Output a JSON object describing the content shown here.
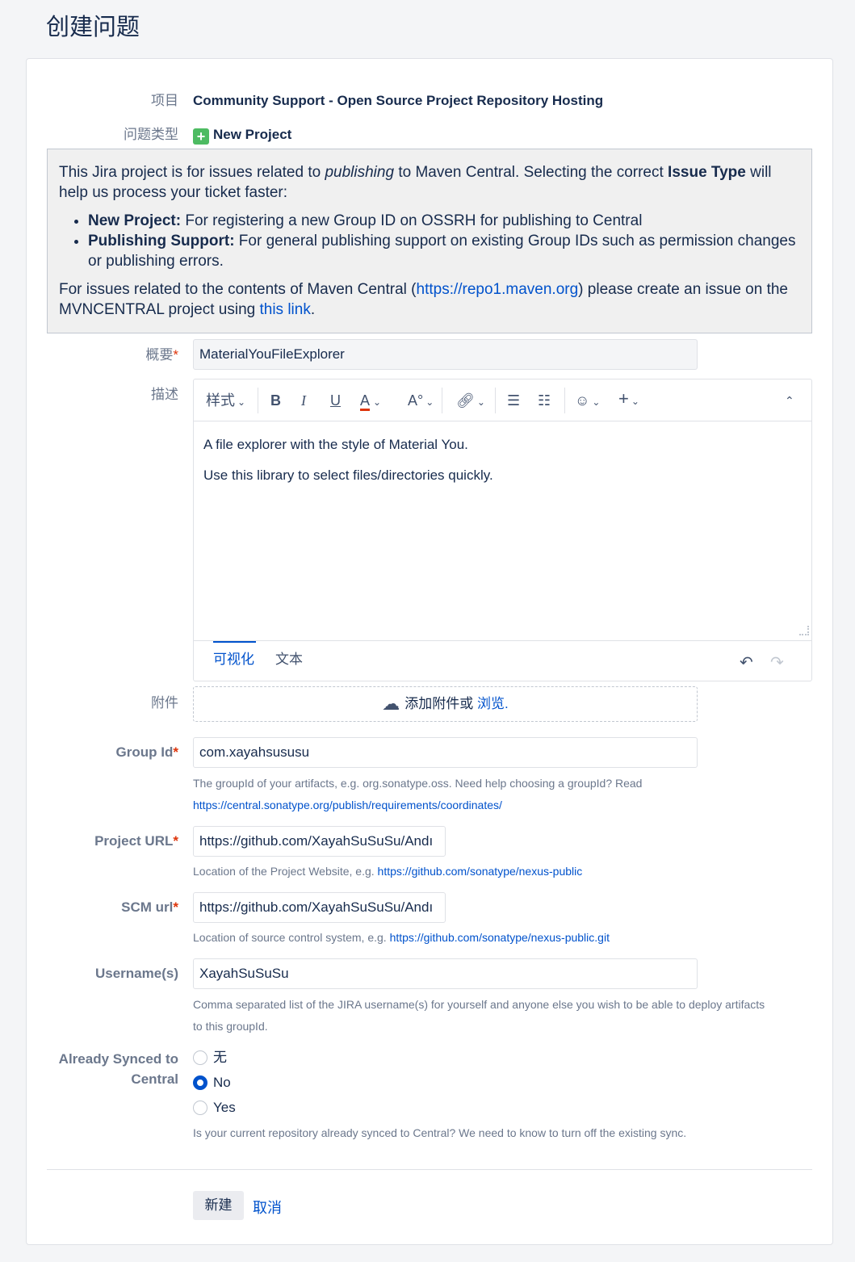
{
  "page_title": "创建问题",
  "fields": {
    "project": {
      "label": "项目",
      "value": "Community Support - Open Source Project Repository Hosting"
    },
    "issue_type": {
      "label": "问题类型",
      "value": "New Project"
    },
    "summary": {
      "label": "概要",
      "value": "MaterialYouFileExplorer"
    },
    "description": {
      "label": "描述",
      "lines": [
        "A file explorer with the style of Material You.",
        "Use this library to select files/directories quickly."
      ]
    },
    "attachment": {
      "label": "附件",
      "text": "添加附件或",
      "link": "浏览."
    },
    "group_id": {
      "label": "Group Id",
      "value": "com.xayahsususu",
      "help": "The groupId of your artifacts, e.g. org.sonatype.oss. Need help choosing a groupId? Read",
      "help_link": "https://central.sonatype.org/publish/requirements/coordinates/"
    },
    "project_url": {
      "label": "Project URL",
      "value": "https://github.com/XayahSuSuSu/Andı",
      "help": "Location of the Project Website, e.g.",
      "help_link": "https://github.com/sonatype/nexus-public"
    },
    "scm_url": {
      "label": "SCM url",
      "value": "https://github.com/XayahSuSuSu/Andı",
      "help": "Location of source control system, e.g.",
      "help_link": "https://github.com/sonatype/nexus-public.git"
    },
    "usernames": {
      "label": "Username(s)",
      "value": "XayahSuSuSu",
      "help_line1": "Comma separated list of the JIRA username(s) for yourself and anyone else you wish to be able to deploy artifacts",
      "help_line2": "to this groupId."
    },
    "synced": {
      "label_line1": "Already Synced to",
      "label_line2": "Central",
      "options": [
        "无",
        "No",
        "Yes"
      ],
      "selected": "No",
      "help": "Is your current repository already synced to Central? We need to know to turn off the existing sync."
    }
  },
  "info": {
    "p1_a": "This Jira project is for issues related to ",
    "p1_em": "publishing",
    "p1_b": " to Maven Central. Selecting the correct ",
    "p1_strong": "Issue Type",
    "p1_c": " will help us process your ticket faster:",
    "bullet1_strong": "New Project:",
    "bullet1_text": " For registering a new Group ID on OSSRH for publishing to Central",
    "bullet2_strong": "Publishing Support:",
    "bullet2_text": " For general publishing support on existing Group IDs such as permission changes or publishing errors.",
    "p2_a": "For issues related to the contents of Maven Central (",
    "p2_link": "https://repo1.maven.org",
    "p2_b": ") please create an issue on the MVNCENTRAL project using ",
    "p2_link2": "this link",
    "p2_c": "."
  },
  "editor": {
    "style_label": "样式",
    "tab_visual": "可视化",
    "tab_text": "文本",
    "accent": "#0052cc"
  },
  "buttons": {
    "create": "新建",
    "cancel": "取消"
  }
}
